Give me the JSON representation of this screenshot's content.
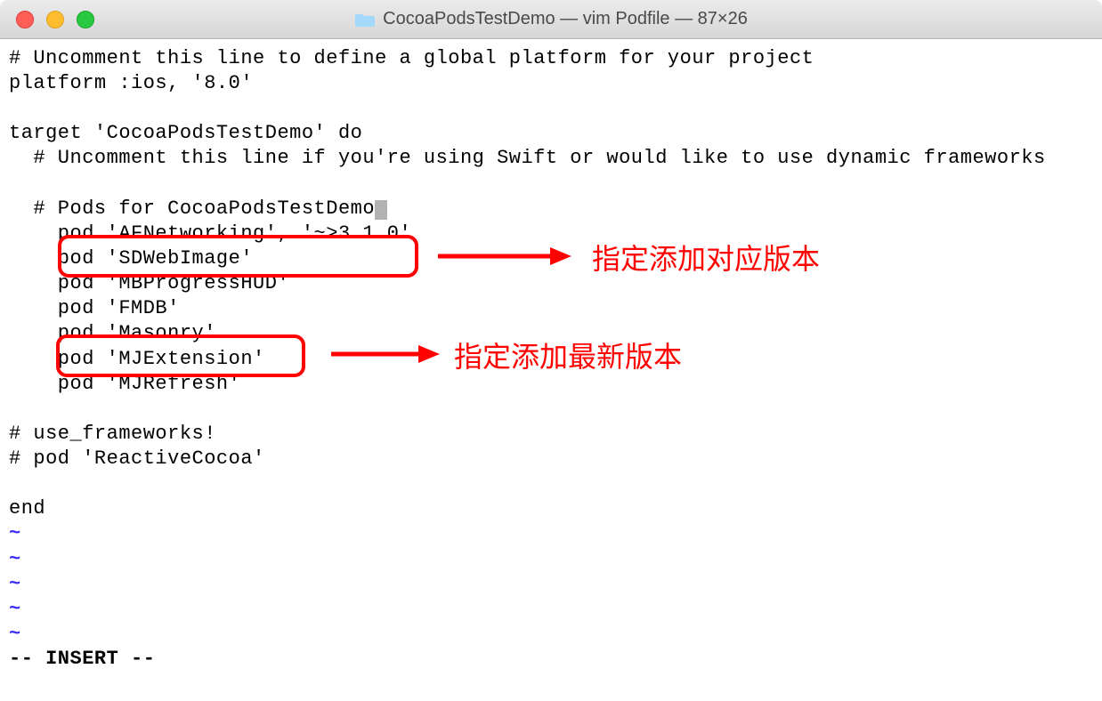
{
  "window": {
    "title": "CocoaPodsTestDemo — vim Podfile — 87×26"
  },
  "editor": {
    "lines": [
      "# Uncomment this line to define a global platform for your project",
      "platform :ios, '8.0'",
      "",
      "target 'CocoaPodsTestDemo' do",
      "  # Uncomment this line if you're using Swift or would like to use dynamic frameworks",
      "",
      "  # Pods for CocoaPodsTestDemo",
      "    pod 'AFNetworking', '~>3.1.0'",
      "    pod 'SDWebImage'",
      "    pod 'MBProgressHUD'",
      "    pod 'FMDB'",
      "    pod 'Masonry'",
      "    pod 'MJExtension'",
      "    pod 'MJRefresh'",
      "",
      "# use_frameworks!",
      "# pod 'ReactiveCocoa'",
      "",
      "end"
    ],
    "empty_line_marker": "~",
    "empty_line_count": 5,
    "mode_line": "-- INSERT --",
    "cursor_line_index": 6
  },
  "annotations": {
    "box1_note": "指定添加对应版本",
    "box2_note": "指定添加最新版本"
  }
}
